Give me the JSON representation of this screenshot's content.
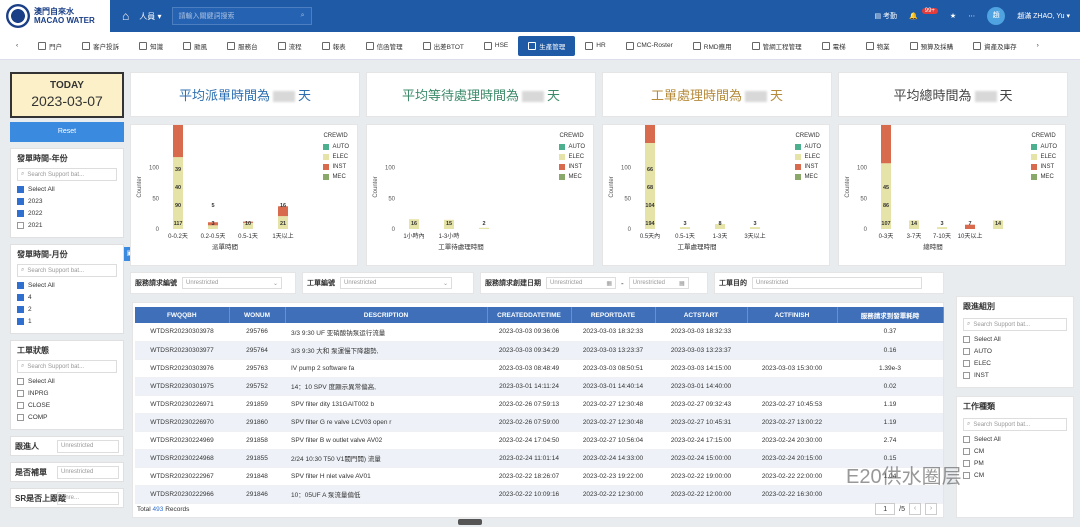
{
  "header": {
    "logo_line1": "澳門自來水",
    "logo_line2": "MACAO WATER",
    "people_label": "人員 ▾",
    "search_placeholder": "請輸入關鍵詞搜索",
    "attendance": "考勤",
    "notify_count": "99+",
    "avatar_initial": "趙",
    "user_name": "趙滿 ZHAO, Yu ▾"
  },
  "menu": [
    {
      "label": "門户",
      "active": false
    },
    {
      "label": "客户投訴",
      "active": false
    },
    {
      "label": "知識",
      "active": false
    },
    {
      "label": "颱風",
      "active": false
    },
    {
      "label": "服務台",
      "active": false
    },
    {
      "label": "流程",
      "active": false
    },
    {
      "label": "報表",
      "active": false
    },
    {
      "label": "信函管理",
      "active": false
    },
    {
      "label": "出差BTOT",
      "active": false
    },
    {
      "label": "HSE",
      "active": false
    },
    {
      "label": "生產管理",
      "active": true
    },
    {
      "label": "HR",
      "active": false
    },
    {
      "label": "CMC-Roster",
      "active": false
    },
    {
      "label": "RMD應用",
      "active": false
    },
    {
      "label": "管網工程管理",
      "active": false
    },
    {
      "label": "電梯",
      "active": false
    },
    {
      "label": "物業",
      "active": false
    },
    {
      "label": "預算及採購",
      "active": false
    },
    {
      "label": "資產及庫存",
      "active": false
    }
  ],
  "today": {
    "title": "TODAY",
    "date": "2023-03-07"
  },
  "reset_label": "Reset",
  "filters": {
    "year": {
      "title": "發單時間-年份",
      "search": "Search Support bat...",
      "items": [
        {
          "label": "Select All",
          "checked": "partial"
        },
        {
          "label": "2023",
          "checked": true
        },
        {
          "label": "2022",
          "checked": true
        },
        {
          "label": "2021",
          "checked": false
        }
      ]
    },
    "month": {
      "title": "發單時間-月份",
      "search": "Search Support bat...",
      "items": [
        {
          "label": "Select All",
          "checked": true
        },
        {
          "label": "4",
          "checked": true
        },
        {
          "label": "2",
          "checked": true
        },
        {
          "label": "1",
          "checked": true
        }
      ]
    },
    "status": {
      "title": "工單狀態",
      "search": "Search Support bat...",
      "items": [
        {
          "label": "Select All",
          "checked": false
        },
        {
          "label": "INPRG",
          "checked": false
        },
        {
          "label": "CLOSE",
          "checked": false
        },
        {
          "label": "COMP",
          "checked": false
        }
      ]
    },
    "follower": {
      "label": "跟進人",
      "value": "Unrestricted"
    },
    "reworked": {
      "label": "是否補單",
      "value": "Unrestricted"
    },
    "sr_tracked": {
      "label": "SR是否上跟蹤",
      "value": "Unre..."
    }
  },
  "kpis": [
    {
      "label": "平均派單時間為",
      "unit": "天",
      "color": "#2d6fb0"
    },
    {
      "label": "平均等待處理時間為",
      "unit": "天",
      "color": "#3c8a6a"
    },
    {
      "label": "工單處理時間為",
      "unit": "天",
      "color": "#b58a3a"
    },
    {
      "label": "平均總時間為",
      "unit": "天",
      "color": "#444444"
    }
  ],
  "charts": {
    "colors": {
      "AUTO": "#4caf8e",
      "ELEC": "#e5e3a7",
      "INST": "#d86a4e",
      "MEC": "#8aa86a"
    },
    "legend_title": "CREWID",
    "legend_items": [
      "AUTO",
      "ELEC",
      "INST",
      "MEC"
    ],
    "ylabel": "Counter",
    "panels": [
      {
        "xlabel": "派單時間",
        "yticks": [
          "100",
          "50",
          "0"
        ],
        "ylim": [
          0,
          140
        ],
        "categories": [
          "0-0.2天",
          "0.2-0.5天",
          "0.5-1天",
          "1天以上"
        ],
        "stacks": [
          [
            {
              "crew": "AUTO",
              "value": 0
            },
            {
              "crew": "ELEC",
              "value": 117
            },
            {
              "crew": "INST",
              "value": 90
            },
            {
              "crew": "MEC",
              "value": 40
            }
          ],
          [
            {
              "crew": "AUTO",
              "value": 0
            },
            {
              "crew": "ELEC",
              "value": 6
            },
            {
              "crew": "INST",
              "value": 5
            },
            {
              "crew": "MEC",
              "value": 0
            }
          ],
          [
            {
              "crew": "AUTO",
              "value": 0
            },
            {
              "crew": "ELEC",
              "value": 10
            },
            {
              "crew": "INST",
              "value": 2
            },
            {
              "crew": "MEC",
              "value": 0
            }
          ],
          [
            {
              "crew": "AUTO",
              "value": 0
            },
            {
              "crew": "ELEC",
              "value": 21
            },
            {
              "crew": "INST",
              "value": 16
            },
            {
              "crew": "MEC",
              "value": 0
            }
          ]
        ],
        "labels": [
          [
            "117",
            "90",
            "40",
            "39"
          ],
          [
            "3",
            "5"
          ],
          [
            "10"
          ],
          [
            "21",
            "16"
          ]
        ]
      },
      {
        "xlabel": "工單待處理時間",
        "yticks": [
          "100",
          "50",
          "0"
        ],
        "ylim": [
          0,
          140
        ],
        "categories": [
          "1小時內",
          "1-3小時"
        ],
        "stacks": [
          [
            {
              "crew": "ELEC",
              "value": 16
            }
          ],
          [
            {
              "crew": "ELEC",
              "value": 15
            }
          ],
          [
            {
              "crew": "ELEC",
              "value": 2
            }
          ]
        ],
        "labels": [
          [
            "16"
          ],
          [
            "15"
          ],
          [
            "2"
          ]
        ]
      },
      {
        "xlabel": "工單處理時間",
        "yticks": [
          "100",
          "50",
          "0"
        ],
        "ylim": [
          0,
          140
        ],
        "categories": [
          "0.5天內",
          "0.5-1天",
          "1-3天",
          "3天以上"
        ],
        "stacks": [
          [
            {
              "crew": "AUTO",
              "value": 0
            },
            {
              "crew": "ELEC",
              "value": 194
            },
            {
              "crew": "INST",
              "value": 104
            },
            {
              "crew": "MEC",
              "value": 68
            }
          ],
          [
            {
              "crew": "ELEC",
              "value": 3
            }
          ],
          [
            {
              "crew": "ELEC",
              "value": 8
            }
          ],
          [
            {
              "crew": "ELEC",
              "value": 3
            }
          ]
        ],
        "labels": [
          [
            "194",
            "104",
            "68",
            "66"
          ],
          [
            "3"
          ],
          [
            "8"
          ],
          [
            "3"
          ]
        ]
      },
      {
        "xlabel": "總時間",
        "yticks": [
          "100",
          "50",
          "0"
        ],
        "ylim": [
          0,
          140
        ],
        "categories": [
          "0-3天",
          "3-7天",
          "7-10天",
          "10天以上"
        ],
        "stacks": [
          [
            {
              "crew": "AUTO",
              "value": 0
            },
            {
              "crew": "ELEC",
              "value": 107
            },
            {
              "crew": "INST",
              "value": 86
            },
            {
              "crew": "MEC",
              "value": 40
            }
          ],
          [
            {
              "crew": "ELEC",
              "value": 14
            }
          ],
          [
            {
              "crew": "ELEC",
              "value": 3
            }
          ],
          [
            {
              "crew": "INST",
              "value": 7
            }
          ],
          [
            {
              "crew": "ELEC",
              "value": 14
            }
          ]
        ],
        "labels": [
          [
            "107",
            "86",
            "45"
          ],
          [
            "14"
          ],
          [
            "3"
          ],
          [
            "7"
          ],
          [
            "14"
          ]
        ]
      }
    ]
  },
  "strip": {
    "sr_code": {
      "label": "服務請求編號",
      "value": "Unrestricted"
    },
    "wo_code": {
      "label": "工單編號",
      "value": "Unrestricted"
    },
    "sr_date": {
      "label": "服務請求創建日期",
      "value": "Unrestricted",
      "sep": "-"
    },
    "wo_purpose": {
      "label": "工單目的",
      "value": "Unrestricted"
    }
  },
  "table": {
    "columns": [
      "FWQQBH",
      "WONUM",
      "DESCRIPTION",
      "CREATEDDATETIME",
      "REPORTDATE",
      "ACTSTART",
      "ACTFINISH",
      "服務請求到發單耗時"
    ],
    "rows": [
      [
        "WTDSR20230303978",
        "295766",
        "3/3 9:30 UF 亚硝酸钠泵运行流量",
        "2023-03-03 09:36:06",
        "2023-03-03 18:32:33",
        "2023-03-03 18:32:33",
        "",
        "0.37"
      ],
      [
        "WTDSR20230303977",
        "295764",
        "3/3 9:30 大和 泵運慢下降趨勢,",
        "2023-03-03 09:34:29",
        "2023-03-03 13:23:37",
        "2023-03-03 13:23:37",
        "",
        "0.16"
      ],
      [
        "WTDSR20230303976",
        "295763",
        "IV pump 2 software fa",
        "2023-03-03 08:48:49",
        "2023-03-03 08:50:51",
        "2023-03-03 14:15:00",
        "2023-03-03 15:30:00",
        "1.39e-3"
      ],
      [
        "WTDSR20230301975",
        "295752",
        "14：10 SPV 度顯示異常偏高,",
        "2023-03-01 14:11:24",
        "2023-03-01 14:40:14",
        "2023-03-01 14:40:00",
        "",
        "0.02"
      ],
      [
        "WTDSR20230226971",
        "291859",
        "SPV filter dity 131GAIT002 b",
        "2023-02-26 07:59:13",
        "2023-02-27 12:30:48",
        "2023-02-27 09:32:43",
        "2023-02-27 10:45:53",
        "1.19"
      ],
      [
        "WTDSR20230226970",
        "291860",
        "SPV filter G re valve LCV03 open r",
        "2023-02-26 07:59:00",
        "2023-02-27 12:30:48",
        "2023-02-27 10:45:31",
        "2023-02-27 13:00:22",
        "1.19"
      ],
      [
        "WTDSR20230224969",
        "291858",
        "SPV filter B w outlet valve AV02",
        "2023-02-24 17:04:50",
        "2023-02-27 10:56:04",
        "2023-02-24 17:15:00",
        "2023-02-24 20:30:00",
        "2.74"
      ],
      [
        "WTDSR20230224968",
        "291855",
        "2/24 10:30 T50 V1閥門開) 流量",
        "2023-02-24 11:01:14",
        "2023-02-24 14:33:00",
        "2023-02-24 15:00:00",
        "2023-02-24 20:15:00",
        "0.15"
      ],
      [
        "WTDSR20230222967",
        "291848",
        "SPV filter H nlet valve AV01",
        "2023-02-22 18:26:07",
        "2023-02-23 19:22:00",
        "2023-02-22 19:00:00",
        "2023-02-22 22:00:00",
        "1.04"
      ],
      [
        "WTDSR20230222966",
        "291846",
        "10：05UF A 泵流量偏低",
        "2023-02-22 10:09:16",
        "2023-02-22 12:30:00",
        "2023-02-22 12:00:00",
        "2023-02-22 16:30:00",
        ""
      ]
    ],
    "total_label": "Total",
    "total_count": "493",
    "records_label": "Records",
    "page": "1",
    "pages": "/5"
  },
  "right": {
    "crew": {
      "title": "跟進組別",
      "search": "Search Support bat...",
      "items": [
        "Select All",
        "AUTO",
        "ELEC",
        "INST"
      ]
    },
    "wo_type": {
      "title": "工作種類",
      "search": "Search Support bat...",
      "items": [
        "Select All",
        "CM",
        "PM",
        "CM"
      ]
    }
  },
  "watermark": "E20供水圈层"
}
